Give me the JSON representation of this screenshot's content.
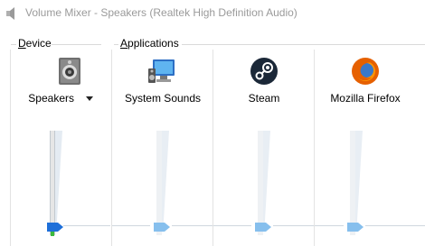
{
  "window": {
    "title": "Volume Mixer - Speakers (Realtek High Definition Audio)",
    "icon": "speaker-icon"
  },
  "groups": {
    "device_hotkey": "D",
    "device_rest": "evice",
    "applications_hotkey": "A",
    "applications_rest": "pplications"
  },
  "device": {
    "name": "Speakers",
    "icon": "speakers-device-icon",
    "volume_percent": 0
  },
  "applications": [
    {
      "name": "System Sounds",
      "icon": "system-sounds-icon",
      "volume_percent": 0
    },
    {
      "name": "Steam",
      "icon": "steam-icon",
      "volume_percent": 0
    },
    {
      "name": "Mozilla Firefox",
      "icon": "firefox-icon",
      "volume_percent": 0
    }
  ],
  "colors": {
    "active_thumb": "#1e6fd9",
    "inactive_thumb": "#86bfed",
    "peak_meter": "#3cba3c",
    "track": "#e6eef6"
  }
}
